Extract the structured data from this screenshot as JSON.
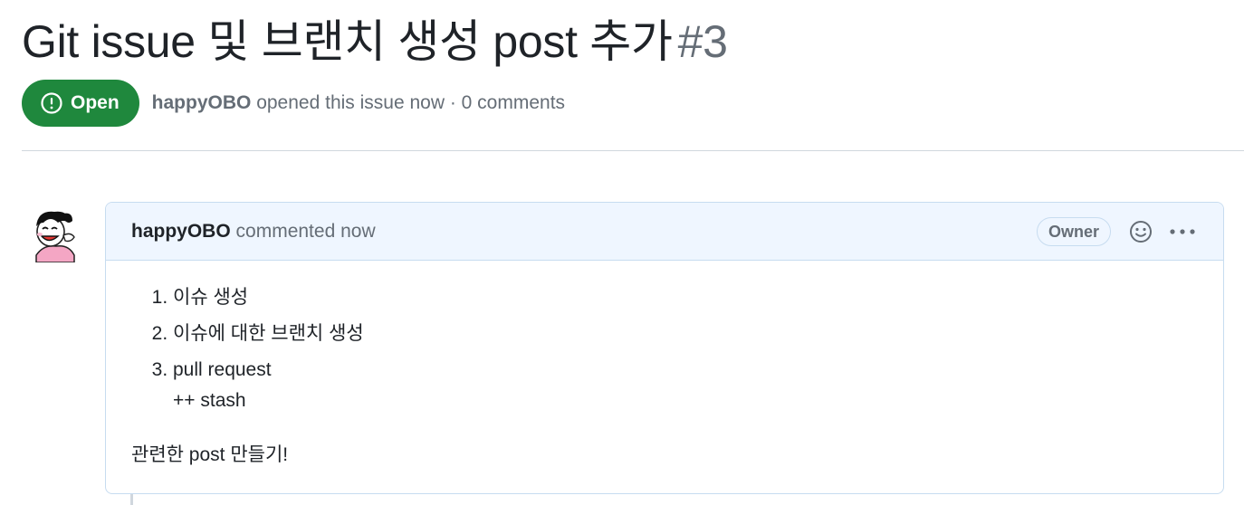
{
  "issue": {
    "title": "Git issue 및 브랜치 생성 post 추가",
    "number": "#3",
    "state": "Open",
    "author": "happyOBO",
    "meta_rest": "opened this issue now · 0 comments"
  },
  "comment": {
    "author": "happyOBO",
    "action": "commented now",
    "role_badge": "Owner",
    "list": [
      {
        "text": "이슈 생성",
        "sub": ""
      },
      {
        "text": "이슈에 대한 브랜치 생성",
        "sub": ""
      },
      {
        "text": "pull request",
        "sub": "++ stash"
      }
    ],
    "paragraph": "관련한 post 만들기!"
  },
  "icons": {
    "state": "issue-opened-icon",
    "reaction": "smiley-icon",
    "more": "kebab-horizontal-icon"
  },
  "colors": {
    "open_green": "#1f883d",
    "header_blue": "#eff6ff",
    "muted_text": "#656d76"
  }
}
